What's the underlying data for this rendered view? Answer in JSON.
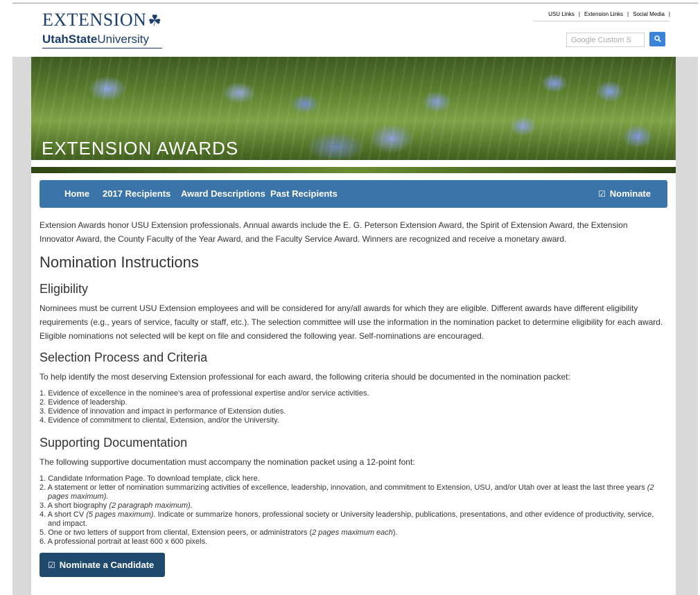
{
  "header": {
    "logo_extension": "EXTENSION",
    "logo_clover": "☘",
    "logo_usu_bold": "UtahState",
    "logo_usu_rest": "University",
    "links": [
      "USU Links",
      "Extension Links",
      "Social Media"
    ],
    "search_placeholder": "Google Custom S",
    "search_icon": "search-icon"
  },
  "banner": {
    "title": "EXTENSION AWARDS"
  },
  "nav": {
    "items": [
      "Home",
      "2017 Recipients",
      "Award Descriptions",
      "Past Recipients"
    ],
    "nominate_label": "Nominate",
    "nominate_icon": "☑"
  },
  "main": {
    "intro": "Extension Awards honor USU Extension professionals. Annual awards include the E. G. Peterson Extension Award, the Spirit of Extension Award, the Extension Innovator Award, the County Faculty of the Year Award, and the Faculty Service Award. Winners are recognized and receive a monetary award.",
    "nomination_heading": "Nomination Instructions",
    "eligibility_heading": "Eligibility",
    "eligibility_text": "Nominees must be current USU Extension employees and will be considered for any/all awards for which they are eligible. Different awards have different eligibility requirements (e.g., years of service, faculty or staff, etc.). The selection committee will use the information in the nomination packet to determine eligibility for each award. Eligible nominations not selected will be kept on file and considered the following year. Self-nominations are encouraged.",
    "selection_heading": "Selection Process and Criteria",
    "selection_intro": "To help identify the most deserving Extension professional for each award, the following criteria should be documented in the nomination packet:",
    "criteria": [
      "1. Evidence of excellence in the nominee’s area of professional expertise and/or service activities.",
      "2. Evidence of leadership.",
      "3. Evidence of innovation and impact in performance of Extension duties.",
      "4. Evidence of commitment to cliental, Extension, and/or the University."
    ],
    "supporting_heading": "Supporting Documentation",
    "supporting_intro": "The following supportive documentation must accompany the nomination packet using a 12-point font:",
    "docs": {
      "d1": "1. Candidate Information Page.  To download template, click here.",
      "d2a": "2. A statement or letter of nomination summarizing activities of excellence, leadership, innovation, and commitment to Extension, USU, and/or Utah over at least the last three years ",
      "d2b": "(2 pages maximum).",
      "d3a": "3. A short biography ",
      "d3b": "(2 paragraph maximum).",
      "d4a": "4. A short CV ",
      "d4b": "(5 pages maximum).",
      "d4c": " Indicate or summarize honors, professional society or University leadership, publications, presentations, and other evidence of productivity, service, and impact.",
      "d5a": "5. One or two letters of support from cliental, Extension peers, or administrators (",
      "d5b": "2 pages maximum each",
      "d5c": ").",
      "d6": "6. A professional portrait at least 600 x 600 pixels."
    },
    "cta_label": "Nominate a Candidate",
    "cta_icon": "☑"
  }
}
